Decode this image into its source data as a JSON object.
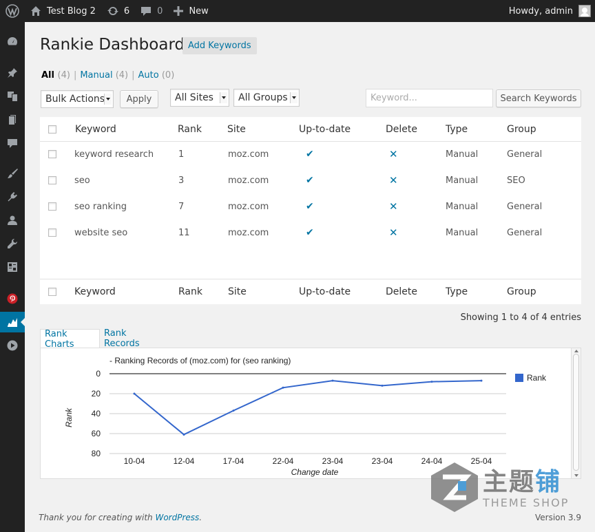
{
  "adminbar": {
    "site_name": "Test Blog 2",
    "updates_count": "6",
    "comments_count": "0",
    "new_label": "New",
    "howdy": "Howdy, admin"
  },
  "page": {
    "title": "Rankie Dashboard",
    "add_button": "Add Keywords"
  },
  "filters": {
    "all_label": "All",
    "all_count": "(4)",
    "manual_label": "Manual",
    "manual_count": "(4)",
    "auto_label": "Auto",
    "auto_count": "(0)",
    "sep": "|"
  },
  "toolbar": {
    "bulk_actions": "Bulk Actions",
    "apply": "Apply",
    "sites": "All Sites",
    "groups": "All Groups",
    "search_placeholder": "Keyword...",
    "search_button": "Search Keywords"
  },
  "table": {
    "columns": [
      "Keyword",
      "Rank",
      "Site",
      "Up-to-date",
      "Delete",
      "Type",
      "Group"
    ],
    "rows": [
      {
        "keyword": "keyword research",
        "rank": "1",
        "site": "moz.com",
        "type": "Manual",
        "group": "General"
      },
      {
        "keyword": "seo",
        "rank": "3",
        "site": "moz.com",
        "type": "Manual",
        "group": "SEO"
      },
      {
        "keyword": "seo ranking",
        "rank": "7",
        "site": "moz.com",
        "type": "Manual",
        "group": "General"
      },
      {
        "keyword": "website seo",
        "rank": "11",
        "site": "moz.com",
        "type": "Manual",
        "group": "General"
      }
    ],
    "uptodate_glyph": "✔",
    "delete_glyph": "✕",
    "showing": "Showing 1 to 4 of 4 entries"
  },
  "tabs": {
    "charts": "Rank Charts",
    "records": "Rank Records"
  },
  "chart_data": {
    "type": "line",
    "title": "- Ranking Records of (moz.com) for (seo ranking)",
    "xlabel": "Change date",
    "ylabel": "Rank",
    "categories": [
      "10-04",
      "12-04",
      "17-04",
      "22-04",
      "23-04",
      "23-04",
      "24-04",
      "25-04"
    ],
    "series": [
      {
        "name": "Rank",
        "values": [
          20,
          61,
          37,
          14,
          7,
          12,
          8,
          7
        ],
        "color": "#3366cc"
      }
    ],
    "ylim": [
      0,
      80
    ],
    "yticks": [
      0,
      20,
      40,
      60,
      80
    ],
    "y_inverted": true,
    "grid": true,
    "legend": "right"
  },
  "footer": {
    "thanks_prefix": "Thank you for creating with ",
    "wordpress": "WordPress",
    "thanks_suffix": ".",
    "version": "Version 3.9"
  },
  "watermark": {
    "cn_gray": "主题",
    "cn_blue": "铺",
    "en": "THEME SHOP"
  },
  "colors": {
    "accent": "#0074a2",
    "adminbar": "#222222",
    "series": "#3366cc"
  },
  "icons": {
    "adminbar": [
      "wordpress-icon",
      "home-icon",
      "updates-icon",
      "comments-icon",
      "plus-icon",
      "avatar"
    ],
    "sidebar": [
      "dashboard-icon",
      "pin-icon",
      "media-icon",
      "pages-icon",
      "comments-icon",
      "appearance-icon",
      "plugins-icon",
      "users-icon",
      "tools-icon",
      "settings-icon",
      "pinterest-icon",
      "rankie-chart-icon",
      "play-icon"
    ]
  }
}
